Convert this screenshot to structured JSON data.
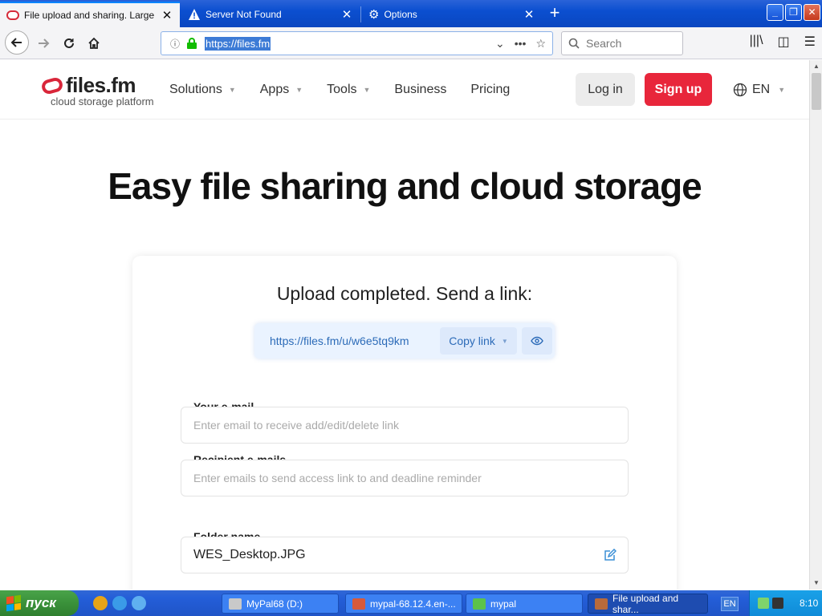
{
  "browser": {
    "tabs": [
      {
        "title": "File upload and sharing. Large file t",
        "icon": "files-fm-favicon",
        "active": true
      },
      {
        "title": "Server Not Found",
        "icon": "warning-icon",
        "active": false
      },
      {
        "title": "Options",
        "icon": "gear-icon",
        "active": false
      }
    ],
    "url": "https://files.fm",
    "search_placeholder": "Search"
  },
  "site": {
    "logo_text": "files.fm",
    "logo_tagline": "cloud storage platform",
    "nav": [
      {
        "label": "Solutions",
        "dropdown": true
      },
      {
        "label": "Apps",
        "dropdown": true
      },
      {
        "label": "Tools",
        "dropdown": true
      },
      {
        "label": "Business",
        "dropdown": false
      },
      {
        "label": "Pricing",
        "dropdown": false
      }
    ],
    "login_label": "Log in",
    "signup_label": "Sign up",
    "language": "EN",
    "brand_color": "#e8263b"
  },
  "hero": {
    "title": "Easy file sharing and cloud storage"
  },
  "upload": {
    "heading": "Upload completed. Send a link:",
    "link_url": "https://files.fm/u/w6e5tq9km",
    "copy_label": "Copy link",
    "email_label": "Your e-mail",
    "email_placeholder": "Enter email to receive add/edit/delete link",
    "recipients_label": "Recipient e-mails",
    "recipients_placeholder": "Enter emails to send access link to and deadline reminder",
    "folder_label": "Folder name",
    "folder_value": "WES_Desktop.JPG"
  },
  "taskbar": {
    "start_label": "пуск",
    "tasks": [
      {
        "label": "MyPal68 (D:)",
        "icon": "drive-icon",
        "active": false
      },
      {
        "label": "mypal-68.12.4.en-...",
        "icon": "archive-icon",
        "active": false
      },
      {
        "label": "mypal",
        "icon": "mypal-icon",
        "active": false
      },
      {
        "label": "File upload and shar...",
        "icon": "browser-icon",
        "active": true
      }
    ],
    "lang_indicator": "EN",
    "clock": "8:10"
  }
}
